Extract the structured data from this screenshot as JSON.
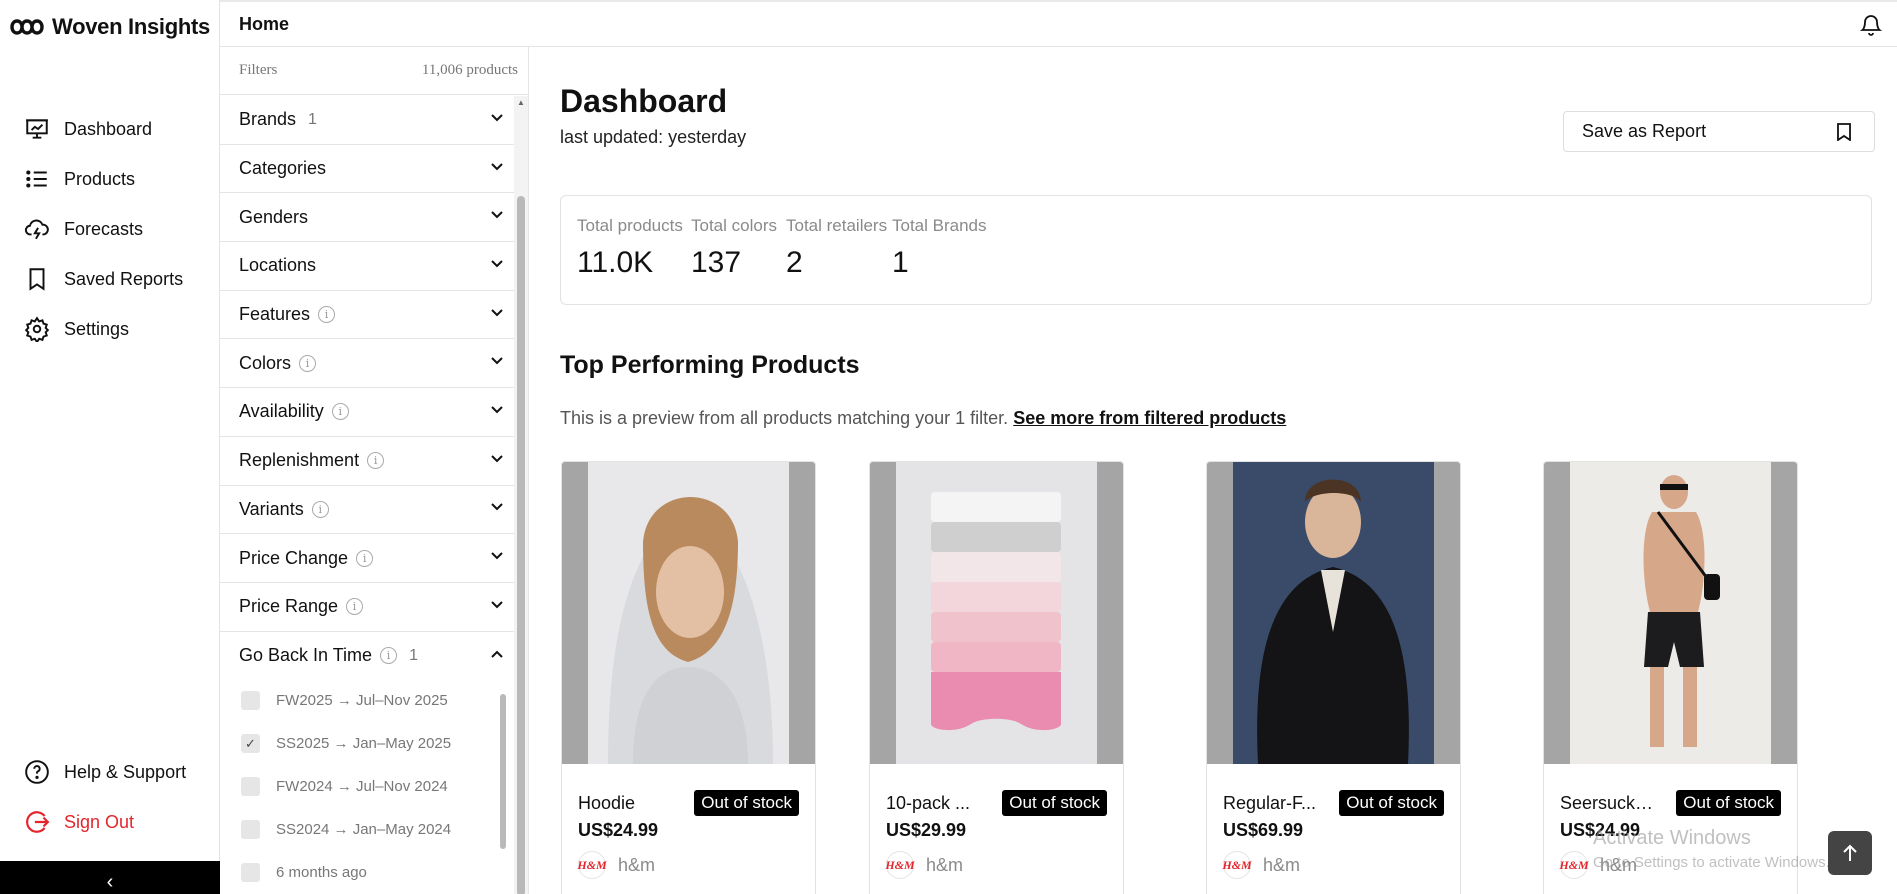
{
  "app": {
    "name": "Woven Insights"
  },
  "sidebar": {
    "items": [
      {
        "label": "Dashboard",
        "icon": "presentation-icon"
      },
      {
        "label": "Products",
        "icon": "list-icon"
      },
      {
        "label": "Forecasts",
        "icon": "cloud-lightning-icon"
      },
      {
        "label": "Saved Reports",
        "icon": "bookmark-icon"
      },
      {
        "label": "Settings",
        "icon": "gear-icon"
      }
    ],
    "bottom": [
      {
        "label": "Help & Support",
        "icon": "help-icon"
      },
      {
        "label": "Sign Out",
        "icon": "sign-out-icon",
        "color": "#e3262c"
      }
    ],
    "collapse_glyph": "‹"
  },
  "topbar": {
    "title": "Home"
  },
  "filters": {
    "header": "Filters",
    "count": "11,006 products",
    "rows": [
      {
        "label": "Brands",
        "count": "1"
      },
      {
        "label": "Categories"
      },
      {
        "label": "Genders"
      },
      {
        "label": "Locations"
      },
      {
        "label": "Features",
        "info": true
      },
      {
        "label": "Colors",
        "info": true
      },
      {
        "label": "Availability",
        "info": true
      },
      {
        "label": "Replenishment",
        "info": true
      },
      {
        "label": "Variants",
        "info": true
      },
      {
        "label": "Price Change",
        "info": true
      },
      {
        "label": "Price Range",
        "info": true
      },
      {
        "label": "Go Back In Time",
        "info": true,
        "count": "1",
        "expanded": true
      }
    ],
    "time_options": [
      {
        "label": "FW2025 → Jul–Nov 2025",
        "checked": false
      },
      {
        "label": "SS2025 → Jan–May 2025",
        "checked": true
      },
      {
        "label": "FW2024 → Jul–Nov 2024",
        "checked": false
      },
      {
        "label": "SS2024 → Jan–May 2024",
        "checked": false
      },
      {
        "label": "6 months ago",
        "checked": false
      }
    ]
  },
  "main": {
    "title": "Dashboard",
    "last_updated": "last updated: yesterday",
    "save_button": "Save as Report",
    "stats": [
      {
        "label": "Total products",
        "value": "11.0K"
      },
      {
        "label": "Total colors",
        "value": "137"
      },
      {
        "label": "Total retailers",
        "value": "2"
      },
      {
        "label": "Total Brands",
        "value": "1"
      }
    ],
    "section_title": "Top Performing Products",
    "preview_text": "This is a preview from all products matching your 1 filter.",
    "preview_link": "See more from filtered products",
    "products": [
      {
        "name": "Hoodie",
        "badge": "Out of stock",
        "price": "US$24.99",
        "brand": "h&m",
        "brand_logo": "H&M"
      },
      {
        "name": "10-pack ...",
        "badge": "Out of stock",
        "price": "US$29.99",
        "brand": "h&m",
        "brand_logo": "H&M"
      },
      {
        "name": "Regular-F...",
        "badge": "Out of stock",
        "price": "US$69.99",
        "brand": "h&m",
        "brand_logo": "H&M"
      },
      {
        "name": "Seersucke...",
        "badge": "Out of stock",
        "price": "US$24.99",
        "brand": "h&m",
        "brand_logo": "H&M"
      }
    ]
  },
  "watermark": {
    "title": "Activate Windows",
    "subtitle": "Go to Settings to activate Windows."
  },
  "colors": {
    "accent_red": "#e3262c",
    "badge_bg": "#000000",
    "muted": "#8a8a8a"
  }
}
